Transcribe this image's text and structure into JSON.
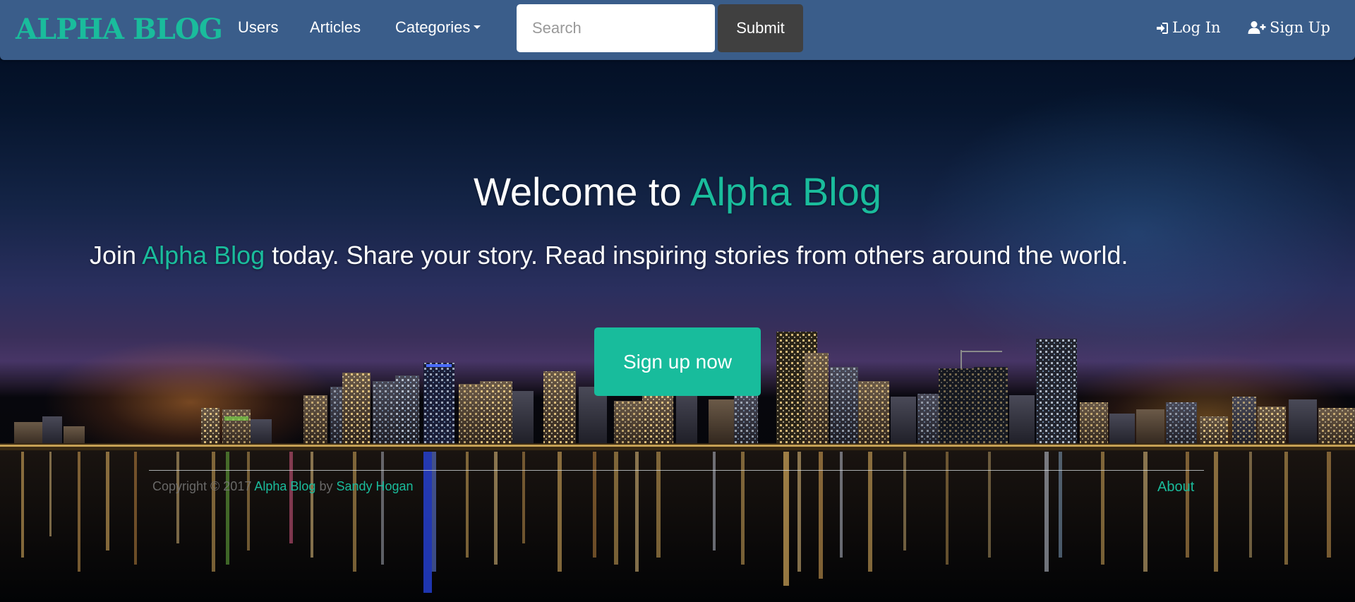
{
  "navbar": {
    "brand": "ALPHA BLOG",
    "links": {
      "users": "Users",
      "articles": "Articles",
      "categories": "Categories"
    },
    "search": {
      "placeholder": "Search",
      "value": ""
    },
    "submit_label": "Submit",
    "login_label": "Log In",
    "signup_label": "Sign Up",
    "icons": {
      "login": "sign-in-icon",
      "signup": "user-plus-icon",
      "categories": "caret-down-icon"
    }
  },
  "hero": {
    "title_prefix": "Welcome to",
    "title_accent": "Alpha Blog",
    "tagline_prefix": "Join",
    "tagline_accent": "Alpha Blog",
    "tagline_suffix": "today. Share your story. Read inspiring stories from others around the world.",
    "cta_label": "Sign up now"
  },
  "footer": {
    "copyright": "Copyright © 2017",
    "site_link": "Alpha Blog",
    "by": "by",
    "author_link": "Sandy Hogan",
    "about_link": "About"
  },
  "colors": {
    "brand_accent": "#1abc9c",
    "navbar_bg": "#3a5d8a",
    "submit_bg": "#404040",
    "cta_bg": "#18bc9c"
  }
}
